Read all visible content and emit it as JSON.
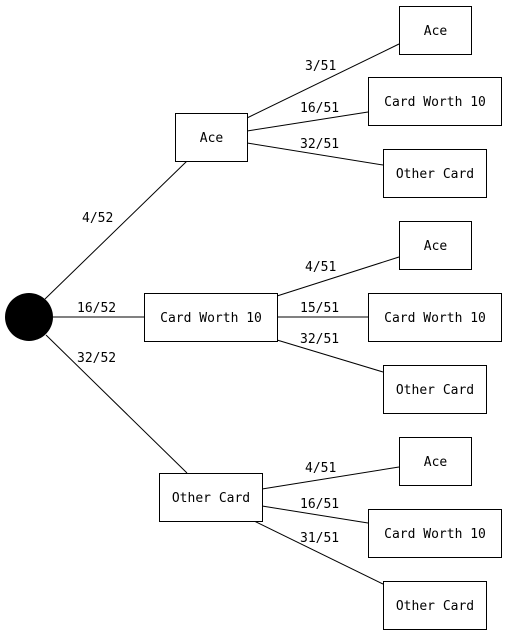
{
  "diagram": {
    "type": "probability-tree",
    "root": {
      "name": "start",
      "shape": "filled-circle",
      "color": "#000000"
    },
    "level1": [
      {
        "label": "Ace",
        "probability": "4/52",
        "children": [
          {
            "label": "Ace",
            "probability": "3/51"
          },
          {
            "label": "Card Worth 10",
            "probability": "16/51"
          },
          {
            "label": "Other Card",
            "probability": "32/51"
          }
        ]
      },
      {
        "label": "Card Worth 10",
        "probability": "16/52",
        "children": [
          {
            "label": "Ace",
            "probability": "4/51"
          },
          {
            "label": "Card Worth 10",
            "probability": "15/51"
          },
          {
            "label": "Other Card",
            "probability": "32/51"
          }
        ]
      },
      {
        "label": "Other Card",
        "probability": "32/52",
        "children": [
          {
            "label": "Ace",
            "probability": "4/51"
          },
          {
            "label": "Card Worth 10",
            "probability": "16/51"
          },
          {
            "label": "Other Card",
            "probability": "31/51"
          }
        ]
      }
    ]
  }
}
